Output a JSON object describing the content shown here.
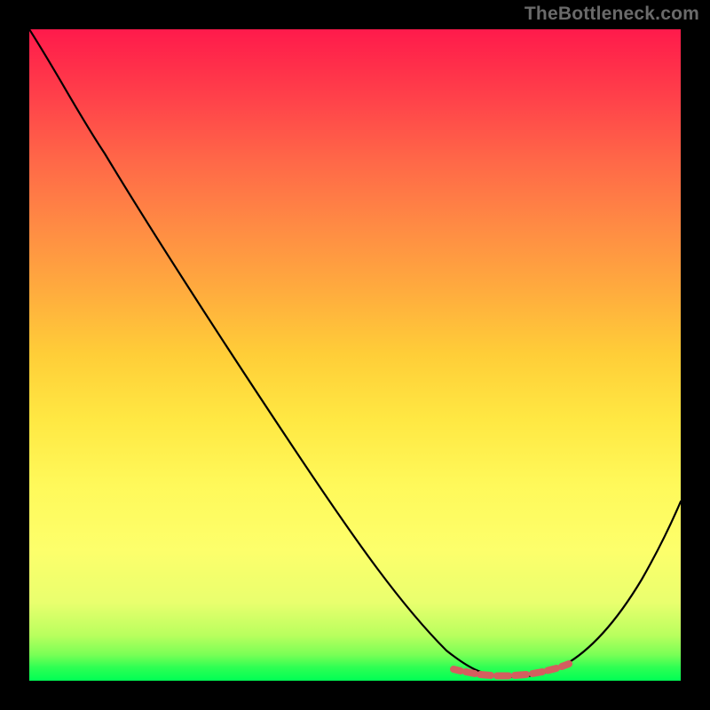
{
  "watermark": "TheBottleneck.com",
  "chart_data": {
    "type": "line",
    "title": "",
    "xlabel": "",
    "ylabel": "",
    "xlim": [
      0,
      100
    ],
    "ylim": [
      0,
      100
    ],
    "grid": false,
    "legend": false,
    "background_gradient": {
      "top": "#ff1a4b",
      "bottom": "#00ff55",
      "style": "vertical red-yellow-green"
    },
    "series": [
      {
        "name": "bottleneck-curve",
        "color": "#000000",
        "x": [
          0,
          8,
          15,
          25,
          35,
          45,
          55,
          62,
          67,
          70,
          73,
          76,
          80,
          83,
          86,
          90,
          95,
          100
        ],
        "y": [
          100,
          92,
          82,
          68,
          53,
          38,
          23,
          12,
          5,
          2,
          0.5,
          0.5,
          1,
          3,
          6,
          11,
          18,
          27
        ]
      }
    ],
    "annotations": [
      {
        "name": "valley-markers",
        "type": "dotted-segment",
        "color": "#d45f5f",
        "approx_x_range": [
          66,
          84
        ],
        "approx_y": 1.2,
        "count": 8
      }
    ]
  }
}
